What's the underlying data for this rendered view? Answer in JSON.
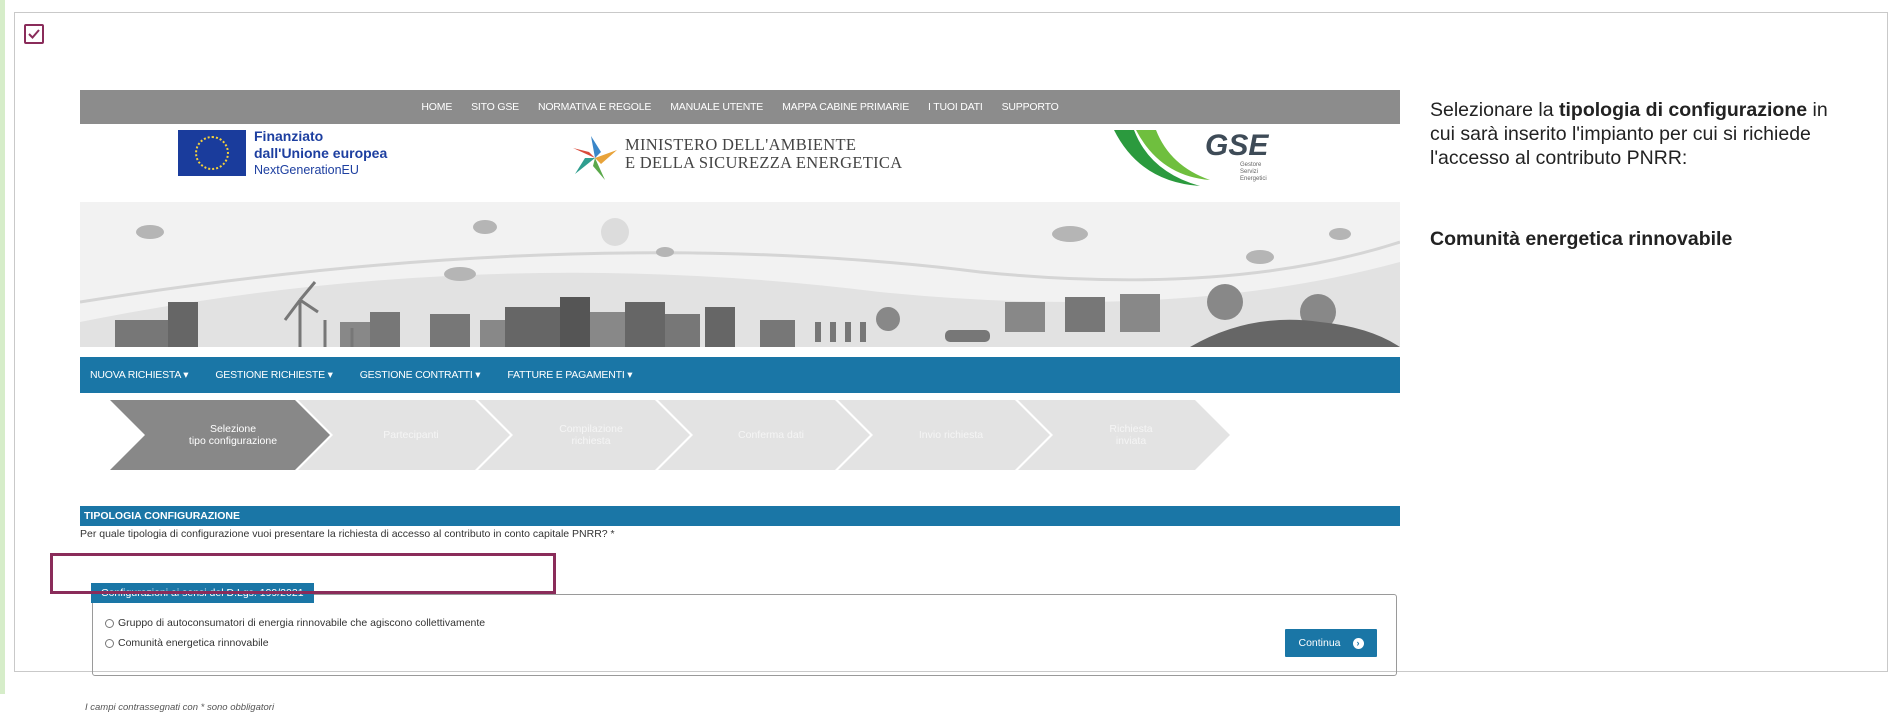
{
  "top_nav": [
    "HOME",
    "SITO GSE",
    "NORMATIVA E REGOLE",
    "MANUALE UTENTE",
    "MAPPA CABINE PRIMARIE",
    "I TUOI DATI",
    "SUPPORTO"
  ],
  "eu_logo": {
    "line1": "Finanziato",
    "line2": "dall'Unione europea",
    "line3": "NextGenerationEU"
  },
  "ministry": {
    "line1": "MINISTERO DELL'AMBIENTE",
    "line2": "E DELLA SICUREZZA ENERGETICA"
  },
  "gse": {
    "word": "GSE",
    "sub1": "Gestore",
    "sub2": "Servizi",
    "sub3": "Energetici"
  },
  "main_nav": [
    "NUOVA RICHIESTA ▾",
    "GESTIONE RICHIESTE ▾",
    "GESTIONE CONTRATTI ▾",
    "FATTURE E PAGAMENTI ▾"
  ],
  "steps": [
    {
      "l1": "Selezione",
      "l2": "tipo configurazione"
    },
    {
      "l1": "Partecipanti",
      "l2": ""
    },
    {
      "l1": "Compilazione",
      "l2": "richiesta"
    },
    {
      "l1": "Conferma dati",
      "l2": ""
    },
    {
      "l1": "Invio richiesta",
      "l2": ""
    },
    {
      "l1": "Richiesta",
      "l2": "inviata"
    }
  ],
  "section_title": "TIPOLOGIA CONFIGURAZIONE",
  "question": "Per quale tipologia di configurazione vuoi presentare la richiesta di accesso al contributo in conto capitale PNRR? *",
  "fieldset_legend": "Configurazioni ai sensi del D.Lgs. 199/2021",
  "options": [
    "Gruppo di autoconsumatori di energia rinnovabile che agiscono collettivamente",
    "Comunità energetica rinnovabile"
  ],
  "note": "I campi contrassegnati con * sono obbligatori",
  "continue_label": "Continua",
  "colors": {
    "accent": "#1a76a6",
    "highlight": "#8a2c5a",
    "topnav": "#8c8c8c"
  },
  "description": {
    "p1_a": "Selezionare la ",
    "p1_b": "tipologia di configurazione",
    "p1_c": " in cui sarà inserito l'impianto per cui si richiede l'accesso al contributo PNRR:",
    "p2": "Comunità energetica rinnovabile"
  }
}
